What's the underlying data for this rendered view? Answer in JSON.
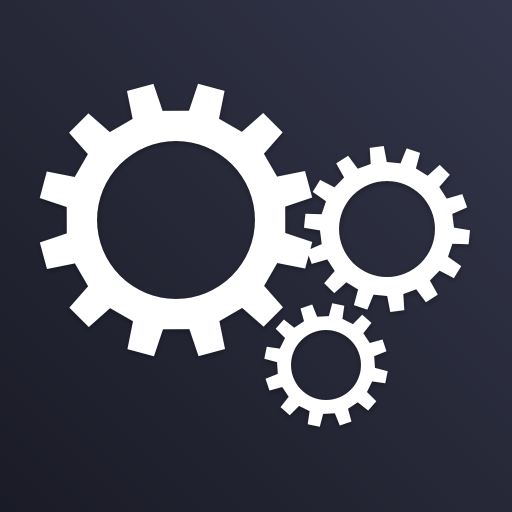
{
  "icon": {
    "name": "settings-gears-icon",
    "gears": [
      {
        "name": "large-gear-icon",
        "teeth": 12
      },
      {
        "name": "medium-gear-icon",
        "teeth": 14
      },
      {
        "name": "small-gear-icon",
        "teeth": 12
      }
    ]
  },
  "colors": {
    "background_light": "#33364a",
    "background_dark": "#1a1b26",
    "gear": "#ffffff"
  }
}
